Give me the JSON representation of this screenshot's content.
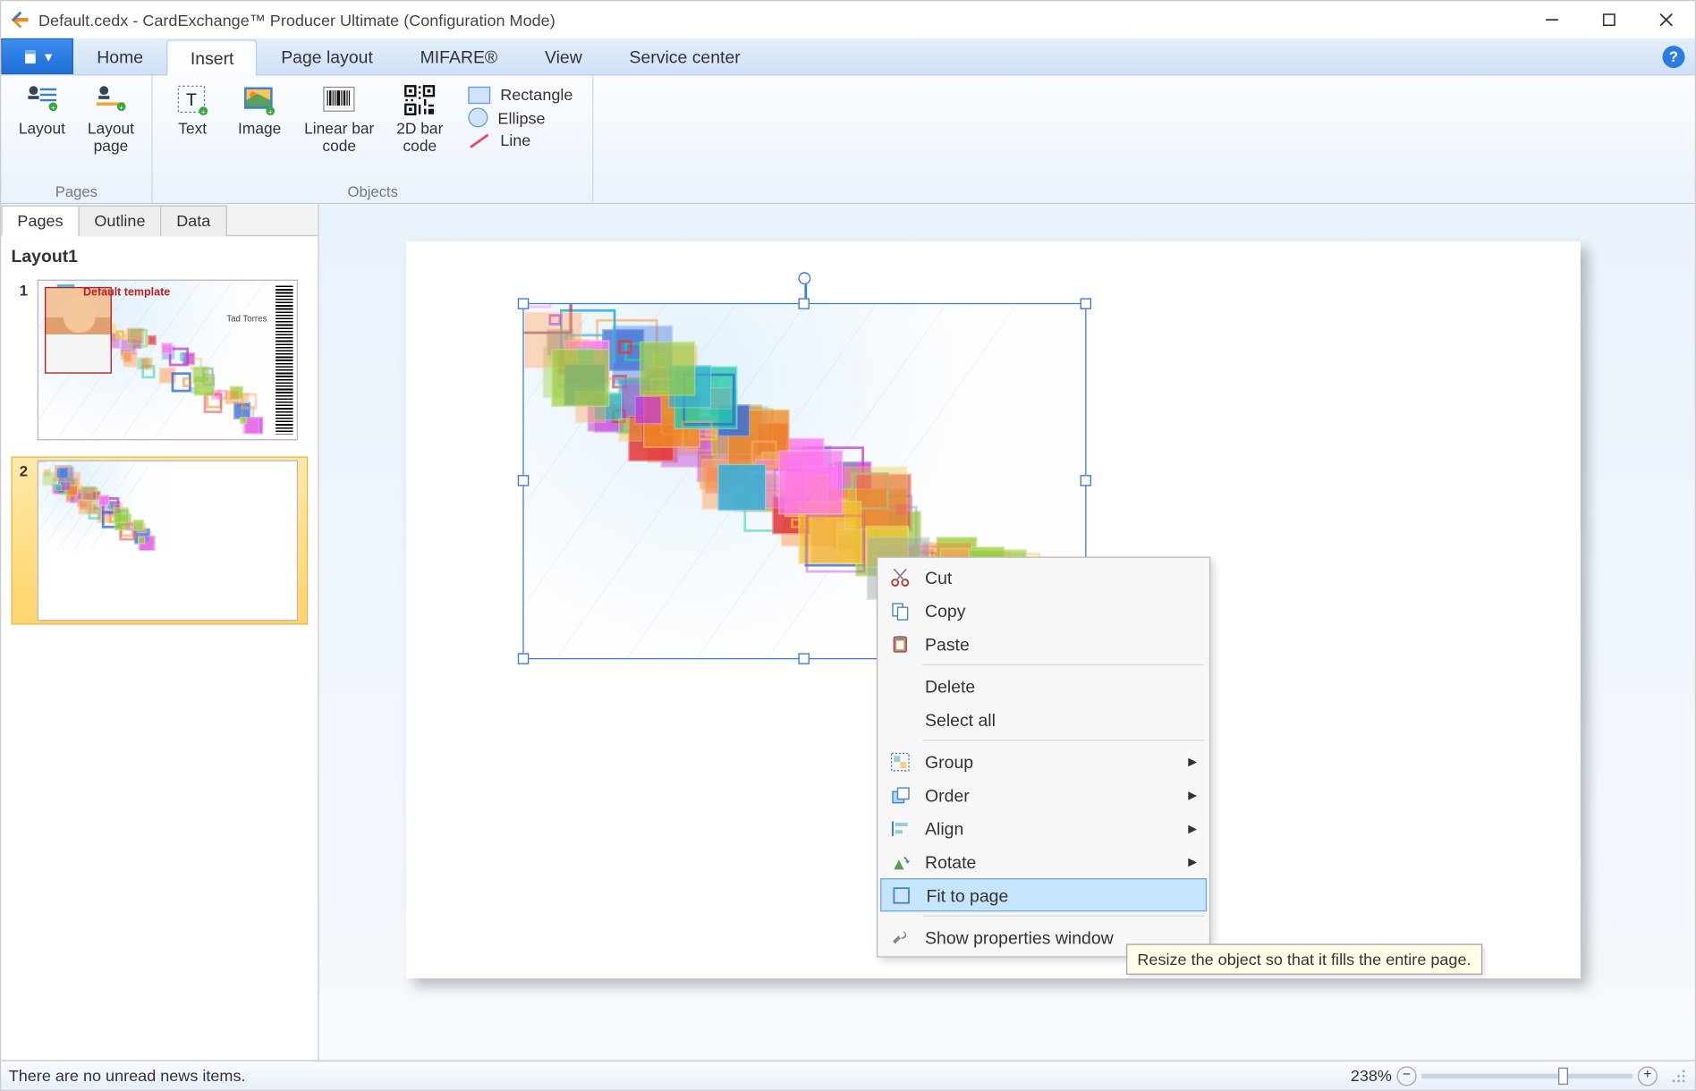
{
  "title_bar": {
    "title": "Default.cedx - CardExchange™ Producer Ultimate (Configuration Mode)"
  },
  "ribbon": {
    "tabs": {
      "home": "Home",
      "insert": "Insert",
      "page_layout": "Page layout",
      "mifare": "MIFARE®",
      "view": "View",
      "service_center": "Service center"
    },
    "groups": {
      "pages": {
        "label": "Pages",
        "layout": "Layout",
        "layout_page": "Layout\npage"
      },
      "objects": {
        "label": "Objects",
        "text": "Text",
        "image": "Image",
        "linear_barcode": "Linear bar\ncode",
        "barcode_2d": "2D bar\ncode"
      },
      "shapes": {
        "rectangle": "Rectangle",
        "ellipse": "Ellipse",
        "line": "Line"
      }
    }
  },
  "side_panel": {
    "tabs": {
      "pages": "Pages",
      "outline": "Outline",
      "data": "Data"
    },
    "layout_title": "Layout1",
    "thumbs": {
      "p1": {
        "num": "1",
        "template_label": "Default template",
        "person_name": "Tad Torres"
      },
      "p2": {
        "num": "2"
      }
    }
  },
  "context_menu": {
    "cut": "Cut",
    "copy": "Copy",
    "paste": "Paste",
    "delete": "Delete",
    "select_all": "Select all",
    "group": "Group",
    "order": "Order",
    "align": "Align",
    "rotate": "Rotate",
    "fit_to_page": "Fit to page",
    "show_properties": "Show properties window"
  },
  "tooltip": {
    "fit_to_page": "Resize the object so that it fills the entire page."
  },
  "status_bar": {
    "news": "There are no unread news items.",
    "zoom": "238%"
  }
}
